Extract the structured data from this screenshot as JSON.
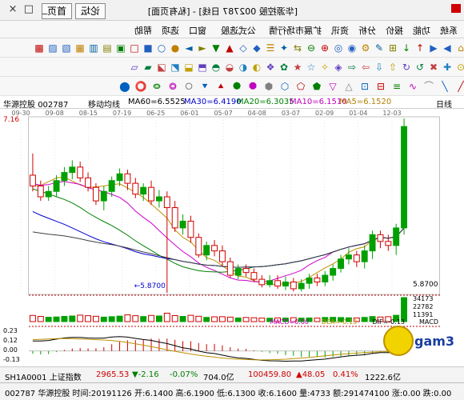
{
  "window": {
    "title": "[华源控股 002787 日线] - [私有页面]",
    "btn_first": "首页",
    "btn_forum": "论坛",
    "tab_stock": "鑫汇",
    "close": "×",
    "max": "□",
    "min": "_"
  },
  "menu": [
    {
      "label": "系统"
    },
    {
      "label": "功能"
    },
    {
      "label": "报价"
    },
    {
      "label": "分析"
    },
    {
      "label": "资讯"
    },
    {
      "label": "扩展市场行情"
    },
    {
      "label": "公式选股"
    },
    {
      "label": "窗口"
    },
    {
      "label": "选项"
    },
    {
      "label": "帮助"
    }
  ],
  "chart_header": {
    "name": "华源控股",
    "code": "002787",
    "period": "日线",
    "ma_label": "移动均线",
    "ma5": "MA5=6.1520",
    "ma10": "MA10=6.1510",
    "ma20": "MA20=6.3035",
    "ma30": "MA30=6.4190",
    "ma60": "MA60=6.5525",
    "dates": [
      "12-03",
      "01-04",
      "02-09",
      "03-07",
      "04-08",
      "05-07",
      "06-01",
      "06-25",
      "07-19",
      "08-15",
      "09-08",
      "09-30"
    ]
  },
  "price_labels": {
    "high": "7.16",
    "low": "5.8700",
    "cursor_low": "5.8700"
  },
  "volume_labels": {
    "v1": "34173",
    "v2": "22782",
    "v3": "11391"
  },
  "macd_header": {
    "name": "MACD",
    "dif": "DIF=-0.13",
    "dea": "DEA=-0.13",
    "macd": "MACD=0.00",
    "axis": [
      "0.23",
      "0.12",
      "0.00",
      "-0.13"
    ]
  },
  "status": {
    "sh": "上证指数",
    "sh_code": "SH1A0001",
    "sh_value": "2965.53",
    "sh_change": "▼-2.16",
    "sh_pct": "-0.07%",
    "sh_amount": "704.0亿",
    "sz_value": "100459.80",
    "sz_change": "▲48.05",
    "sz_pct": "0.41%",
    "sz_amount": "1222.6亿",
    "line2": "002787 华源控股  时间:20191126  开:6.1400  高:6.1900  低:6.1300  收:6.1600  量:4733  额:291474100  涨:0.00  跌:0.00"
  },
  "logo": {
    "text": "gam360"
  },
  "chart_data": {
    "type": "candlestick",
    "title": "华源控股 002787 日线",
    "ylabel": "",
    "ylim": [
      5.87,
      7.16
    ],
    "candles": [
      {
        "o": 7.1,
        "c": 6.35,
        "h": 7.16,
        "l": 6.3
      },
      {
        "o": 6.35,
        "c": 6.22,
        "h": 6.38,
        "l": 6.15
      },
      {
        "o": 6.22,
        "c": 6.25,
        "h": 6.3,
        "l": 6.18
      },
      {
        "o": 6.25,
        "c": 6.3,
        "h": 6.33,
        "l": 6.2
      },
      {
        "o": 6.3,
        "c": 6.18,
        "h": 6.33,
        "l": 6.12
      },
      {
        "o": 6.18,
        "c": 6.1,
        "h": 6.22,
        "l": 6.05
      },
      {
        "o": 6.1,
        "c": 6.15,
        "h": 6.18,
        "l": 6.06
      },
      {
        "o": 6.15,
        "c": 6.12,
        "h": 6.2,
        "l": 6.08
      },
      {
        "o": 6.12,
        "c": 6.05,
        "h": 6.15,
        "l": 6.02
      },
      {
        "o": 6.05,
        "c": 6.0,
        "h": 6.08,
        "l": 5.96
      },
      {
        "o": 6.0,
        "c": 5.95,
        "h": 6.03,
        "l": 5.92
      },
      {
        "o": 5.95,
        "c": 5.98,
        "h": 6.01,
        "l": 5.92
      },
      {
        "o": 5.98,
        "c": 5.94,
        "h": 6.01,
        "l": 5.9
      },
      {
        "o": 5.94,
        "c": 5.9,
        "h": 5.97,
        "l": 5.88
      },
      {
        "o": 5.9,
        "c": 5.95,
        "h": 5.98,
        "l": 5.88
      },
      {
        "o": 5.95,
        "c": 5.92,
        "h": 5.99,
        "l": 5.89
      },
      {
        "o": 5.92,
        "c": 5.96,
        "h": 6.0,
        "l": 5.9
      },
      {
        "o": 5.96,
        "c": 5.93,
        "h": 6.0,
        "l": 5.91
      },
      {
        "o": 5.93,
        "c": 5.97,
        "h": 6.0,
        "l": 5.91
      },
      {
        "o": 5.97,
        "c": 6.02,
        "h": 6.05,
        "l": 5.95
      },
      {
        "o": 6.02,
        "c": 6.05,
        "h": 6.08,
        "l": 5.99
      },
      {
        "o": 6.05,
        "c": 6.0,
        "h": 6.08,
        "l": 5.97
      },
      {
        "o": 6.0,
        "c": 6.1,
        "h": 6.13,
        "l": 5.98
      },
      {
        "o": 6.1,
        "c": 6.18,
        "h": 6.22,
        "l": 6.07
      },
      {
        "o": 6.18,
        "c": 6.22,
        "h": 6.26,
        "l": 6.14
      },
      {
        "o": 6.22,
        "c": 6.15,
        "h": 6.25,
        "l": 6.11
      },
      {
        "o": 6.15,
        "c": 6.28,
        "h": 6.31,
        "l": 6.13
      },
      {
        "o": 6.28,
        "c": 6.4,
        "h": 6.44,
        "l": 6.24
      },
      {
        "o": 6.4,
        "c": 6.35,
        "h": 6.45,
        "l": 6.3
      },
      {
        "o": 6.35,
        "c": 6.5,
        "h": 6.55,
        "l": 6.32
      },
      {
        "o": 6.5,
        "c": 6.58,
        "h": 6.62,
        "l": 5.87
      },
      {
        "o": 6.58,
        "c": 6.55,
        "h": 6.63,
        "l": 6.5
      },
      {
        "o": 6.55,
        "c": 6.65,
        "h": 6.7,
        "l": 6.52
      },
      {
        "o": 6.65,
        "c": 6.6,
        "h": 6.68,
        "l": 6.55
      },
      {
        "o": 6.6,
        "c": 6.68,
        "h": 6.72,
        "l": 6.57
      },
      {
        "o": 6.68,
        "c": 6.75,
        "h": 6.78,
        "l": 6.63
      },
      {
        "o": 6.75,
        "c": 6.7,
        "h": 6.79,
        "l": 6.66
      },
      {
        "o": 6.7,
        "c": 6.62,
        "h": 6.73,
        "l": 6.58
      },
      {
        "o": 6.62,
        "c": 6.55,
        "h": 6.66,
        "l": 6.48
      },
      {
        "o": 6.55,
        "c": 6.65,
        "h": 6.68,
        "l": 6.52
      },
      {
        "o": 6.65,
        "c": 6.72,
        "h": 6.76,
        "l": 6.62
      },
      {
        "o": 6.72,
        "c": 6.8,
        "h": 6.84,
        "l": 6.69
      },
      {
        "o": 6.8,
        "c": 6.76,
        "h": 6.85,
        "l": 6.71
      },
      {
        "o": 6.76,
        "c": 6.7,
        "h": 6.8,
        "l": 6.66
      },
      {
        "o": 6.7,
        "c": 6.62,
        "h": 6.74,
        "l": 6.58
      },
      {
        "o": 6.62,
        "c": 6.58,
        "h": 6.66,
        "l": 6.55
      },
      {
        "o": 6.58,
        "c": 6.66,
        "h": 6.7,
        "l": 6.55
      },
      {
        "o": 6.66,
        "c": 6.74,
        "h": 6.9,
        "l": 6.62
      }
    ],
    "volume": [
      34173,
      9000,
      7000,
      6500,
      7200,
      6000,
      5200,
      5400,
      5800,
      6100,
      5900,
      5000,
      5200,
      4900,
      5600,
      5100,
      5300,
      4800,
      5000,
      5500,
      5900,
      5200,
      6400,
      7000,
      6800,
      6000,
      7600,
      9000,
      7400,
      8600,
      12000,
      8000,
      8800,
      7200,
      8400,
      9600,
      7800,
      7000,
      6400,
      7600,
      8400,
      9200,
      8000,
      7400,
      6600,
      6200,
      7400,
      8800
    ],
    "macd_ylim": [
      -0.13,
      0.23
    ]
  }
}
